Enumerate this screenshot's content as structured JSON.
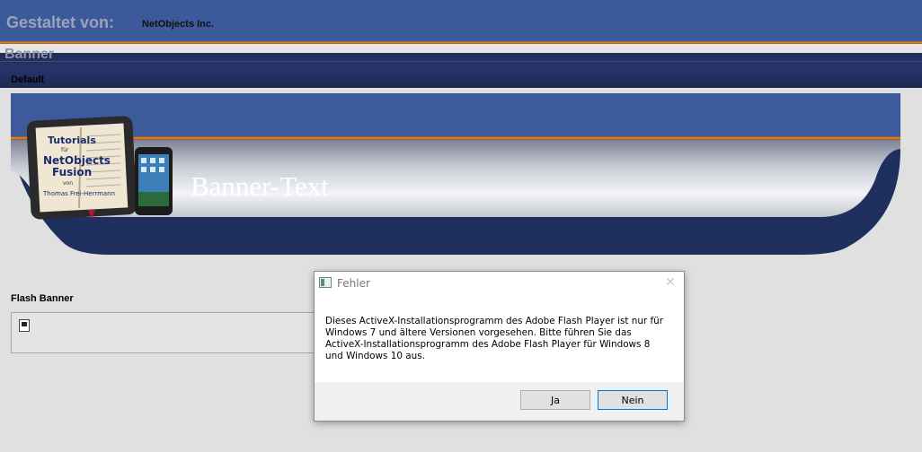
{
  "header": {
    "designer_label": "Gestaltet von:",
    "designer_name": "NetObjects Inc."
  },
  "nav": {
    "banner_label": "Banner",
    "default_label": "Default"
  },
  "banner": {
    "text": "Banner-Text",
    "logo_lines": [
      "Tutorials",
      "für",
      "NetObjects",
      "Fusion",
      "von",
      "Thomas Frei-Herrmann"
    ]
  },
  "flash": {
    "label": "Flash Banner",
    "plugin_icon": "plugin-placeholder-icon"
  },
  "dialog": {
    "title": "Fehler",
    "close_symbol": "✕",
    "message": "Dieses ActiveX-Installationsprogramm des Adobe Flash Player ist nur für Windows 7 und ältere Versionen vorgesehen. Bitte führen Sie das ActiveX-Installationsprogramm des Adobe Flash Player für Windows 8 und Windows 10 aus.",
    "yes_label": "Ja",
    "no_label": "Nein"
  },
  "colors": {
    "header_blue": "#3c5a9b",
    "nav_dark": "#1f2d55",
    "accent_orange": "#d98a3a",
    "page_bg": "#e0e0e0"
  }
}
